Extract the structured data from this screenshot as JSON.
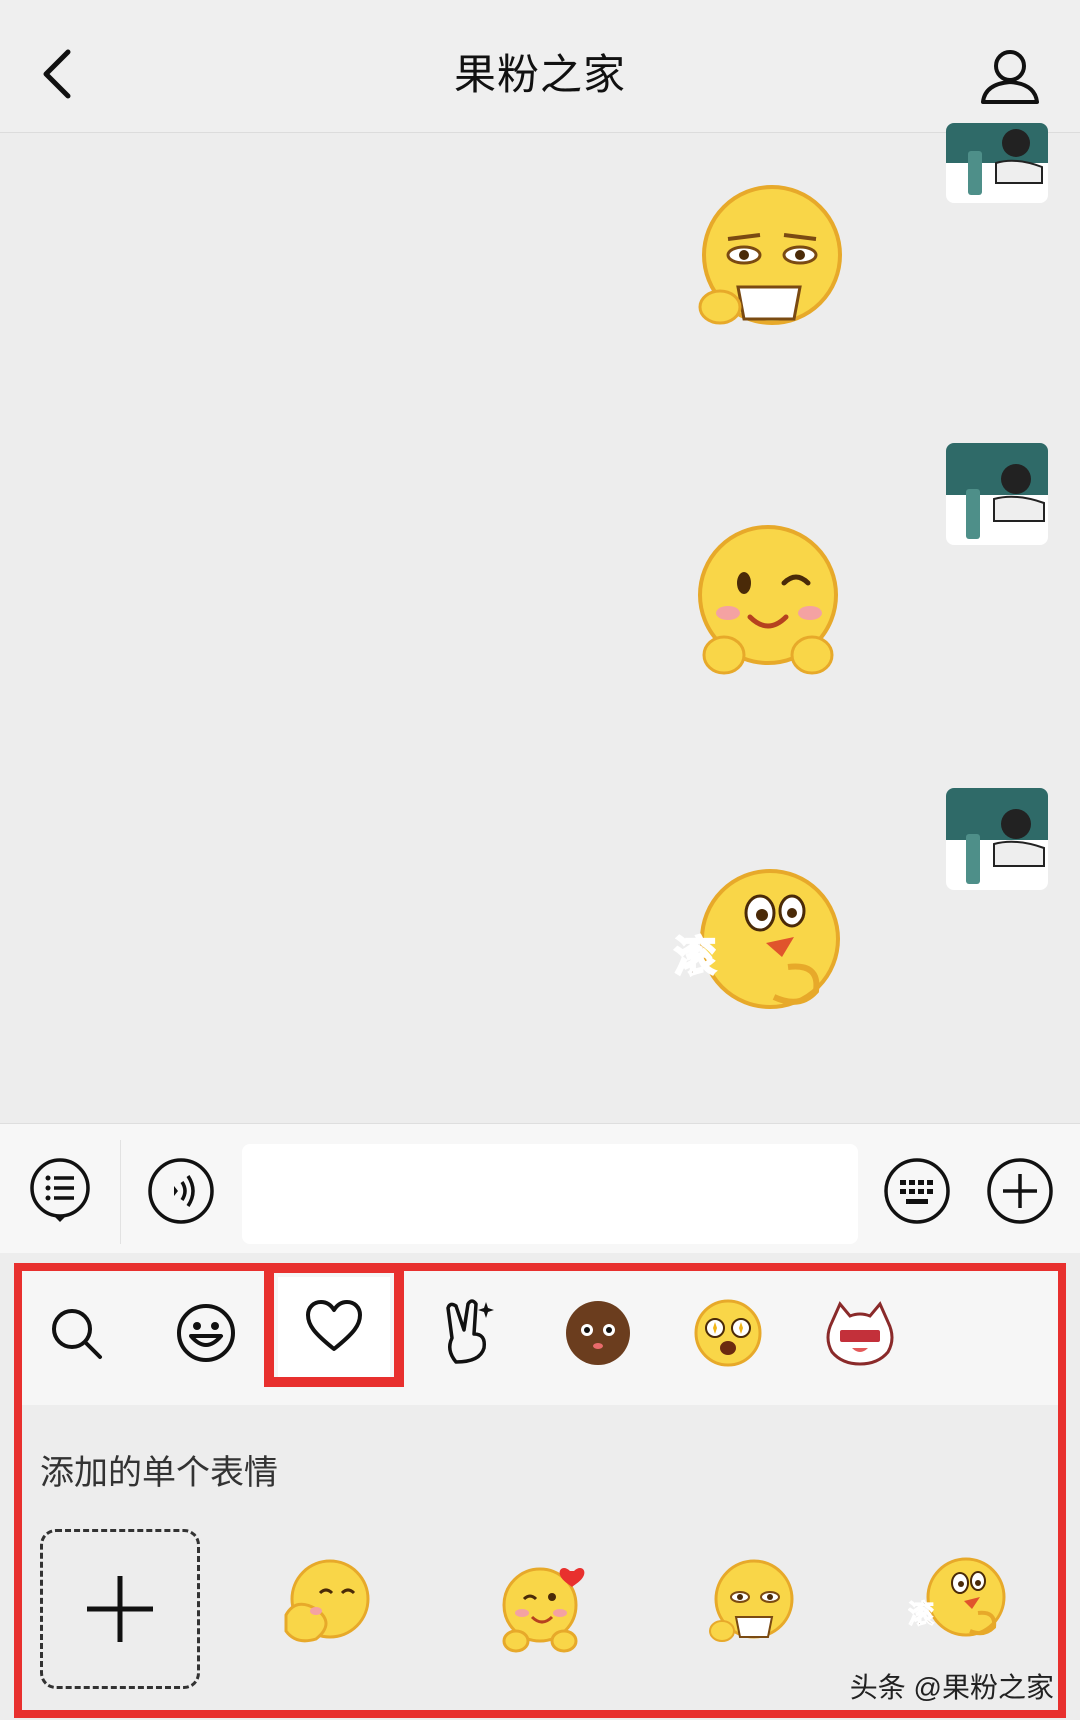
{
  "header": {
    "title": "果粉之家",
    "back_icon": "chevron-left-icon",
    "profile_icon": "person-icon"
  },
  "messages": [
    {
      "sender": "self",
      "sticker": "sipping-tea-emoji"
    },
    {
      "sender": "self",
      "sticker": "wink-blush-emoji"
    },
    {
      "sender": "self",
      "sticker": "roll-emoji",
      "caption": "滚"
    }
  ],
  "input_bar": {
    "left_icons": [
      "list-icon",
      "voice-icon"
    ],
    "right_icons": [
      "keyboard-icon",
      "plus-circle-icon"
    ],
    "text_value": ""
  },
  "emoji_panel": {
    "tabs": [
      {
        "icon": "search-icon"
      },
      {
        "icon": "smiley-icon"
      },
      {
        "icon": "heart-icon",
        "selected": true
      },
      {
        "icon": "victory-hand-icon"
      },
      {
        "icon": "brown-face-icon"
      },
      {
        "icon": "star-eyes-icon"
      },
      {
        "icon": "cat-face-icon"
      }
    ],
    "section_label": "添加的单个表情",
    "favorites": [
      {
        "name": "add-sticker",
        "icon": "plus-icon"
      },
      {
        "name": "hug-emoji"
      },
      {
        "name": "heart-blush-emoji"
      },
      {
        "name": "sipping-tea-emoji"
      },
      {
        "name": "roll-emoji",
        "caption": "滚"
      }
    ]
  },
  "watermark": "头条 @果粉之家",
  "colors": {
    "highlight": "#e8302e",
    "emoji_yellow": "#f9d648",
    "avatar_teal": "#2f6a68"
  }
}
